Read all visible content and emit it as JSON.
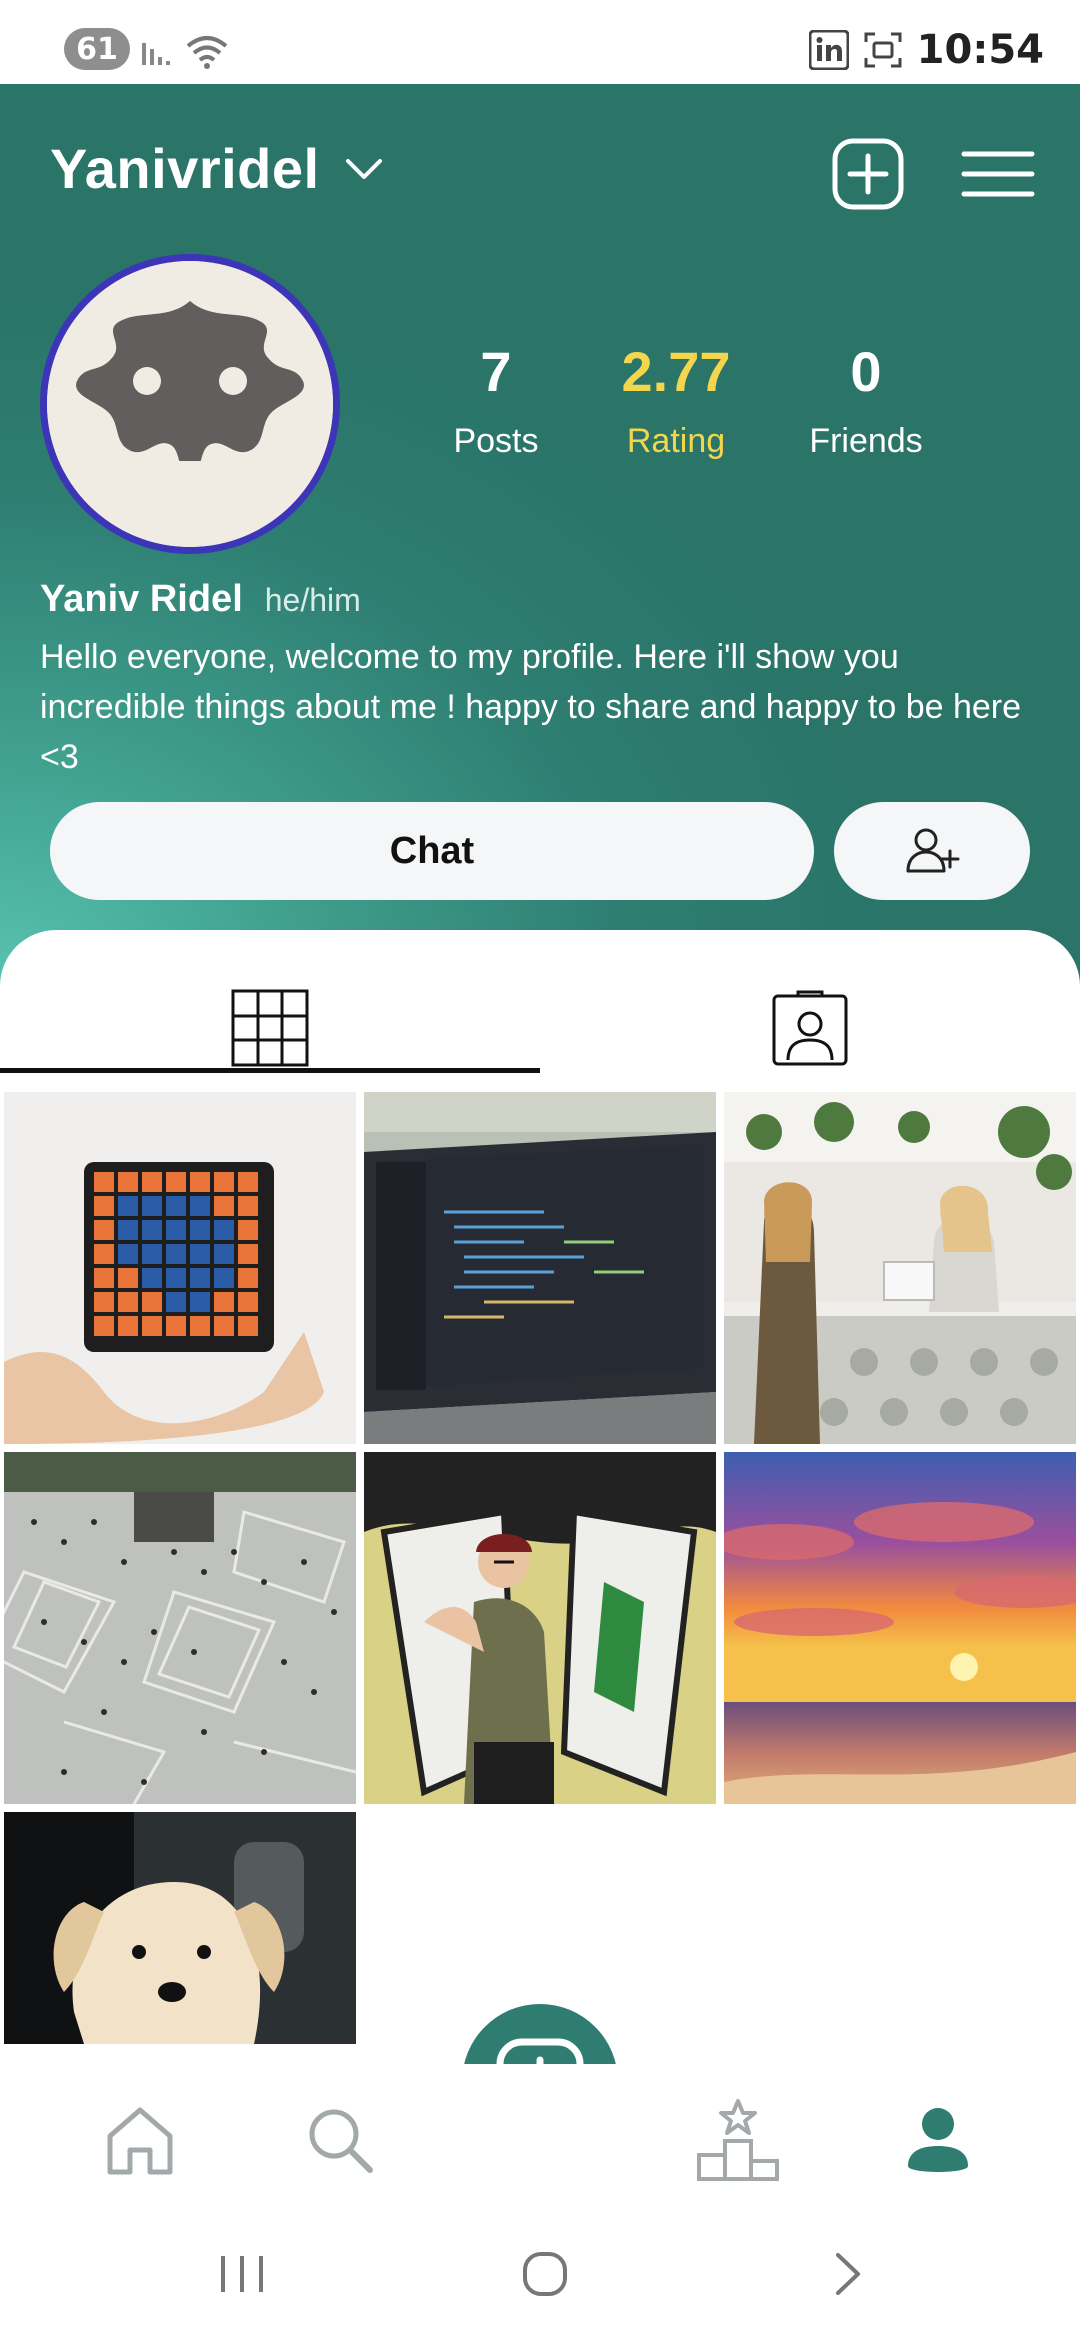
{
  "status_bar": {
    "battery": "61",
    "time": "10:54",
    "icons": [
      "signal-icon",
      "wifi-icon",
      "linkedin-icon",
      "screenshot-icon"
    ]
  },
  "header": {
    "username": "Yanivridel",
    "stats": [
      {
        "value": "7",
        "label": "Posts"
      },
      {
        "value": "2.77",
        "label": "Rating"
      },
      {
        "value": "0",
        "label": "Friends"
      }
    ],
    "display_name": "Yaniv Ridel",
    "pronouns": "he/him",
    "bio": "Hello everyone, welcome to my profile. Here i'll show you incredible things about me ! happy to share and happy to be here <3",
    "chat_label": "Chat",
    "colors": {
      "accent": "#2f7d70",
      "rating": "#f4d64e",
      "avatar_ring": "#3d35b8"
    }
  },
  "tabs": [
    {
      "icon": "grid-icon",
      "active": true
    },
    {
      "icon": "tagged-person-icon",
      "active": false
    }
  ],
  "posts": [
    "rubiks-cube-photo",
    "laptop-code-photo",
    "cafe-counter-photo",
    "city-square-crowd-photo",
    "person-mural-photo",
    "sunset-beach-photo",
    "puppy-photo"
  ],
  "bottom_nav": [
    "home-icon",
    "search-icon",
    "create-post-icon",
    "leaderboard-icon",
    "profile-icon"
  ]
}
